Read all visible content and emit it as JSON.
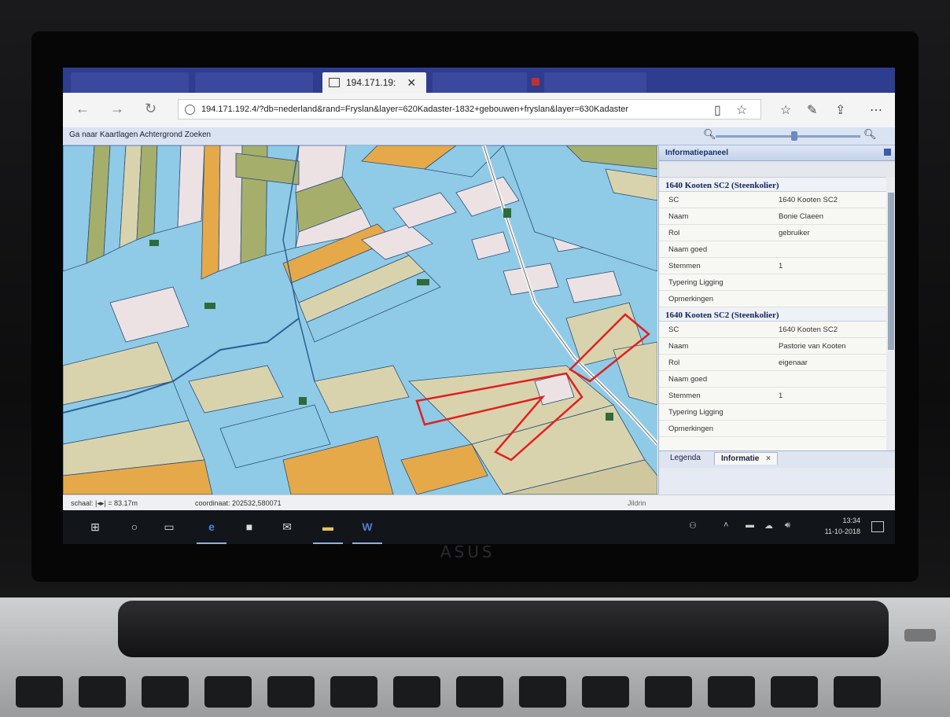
{
  "browser": {
    "active_tab_title": "194.171.19:",
    "url": "194.171.192.4/?db=nederland&rand=Fryslan&layer=620Kadaster-1832+gebouwen+fryslan&layer=630Kadaster"
  },
  "app": {
    "menu": "Ga naar  Kaartlagen  Achtergrond  Zoeken"
  },
  "info_panel": {
    "header": "Informatiepaneel",
    "sections": [
      {
        "title": "1640 Kooten SC2 (Steenkolier)",
        "rows": [
          {
            "key": "SC",
            "value": "1640 Kooten SC2"
          },
          {
            "key": "Naam",
            "value": "Bonie Claeen"
          },
          {
            "key": "Rol",
            "value": "gebruiker"
          },
          {
            "key": "Naam goed",
            "value": ""
          },
          {
            "key": "Stemmen",
            "value": "1"
          },
          {
            "key": "Typering Ligging",
            "value": ""
          },
          {
            "key": "Opmerkingen",
            "value": ""
          }
        ]
      },
      {
        "title": "1640 Kooten SC2 (Steenkolier)",
        "rows": [
          {
            "key": "SC",
            "value": "1640 Kooten SC2"
          },
          {
            "key": "Naam",
            "value": "Pastorie van Kooten"
          },
          {
            "key": "Rol",
            "value": "eigenaar"
          },
          {
            "key": "Naam goed",
            "value": ""
          },
          {
            "key": "Stemmen",
            "value": "1"
          },
          {
            "key": "Typering Ligging",
            "value": ""
          },
          {
            "key": "Opmerkingen",
            "value": ""
          }
        ]
      }
    ],
    "tabs": {
      "legend": "Legenda",
      "info": "Informatie",
      "close": "×"
    }
  },
  "status": {
    "scale": "schaal: |◂▸| = 83.17m",
    "coordinate": "coordinaat: 202532,580071",
    "source": "Jildrin"
  },
  "taskbar": {
    "time": "13:34",
    "date": "11-10-2018"
  },
  "colors": {
    "parcel_blue": "#8fcbe6",
    "parcel_tan": "#d9d3ad",
    "parcel_olive": "#a6ae6c",
    "parcel_orange": "#e6a94a",
    "parcel_pink": "#ece2e4",
    "selection_outline": "#e02020"
  },
  "icons": [
    "back-arrow-icon",
    "forward-arrow-icon",
    "refresh-icon",
    "info-icon",
    "reading-view-icon",
    "favorite-star-icon",
    "favorites-hub-icon",
    "pen-icon",
    "share-icon",
    "more-icon",
    "zoom-out-icon",
    "zoom-in-icon",
    "windows-start-icon",
    "search-icon",
    "task-view-icon",
    "edge-icon",
    "store-icon",
    "mail-icon",
    "explorer-icon",
    "word-icon"
  ]
}
